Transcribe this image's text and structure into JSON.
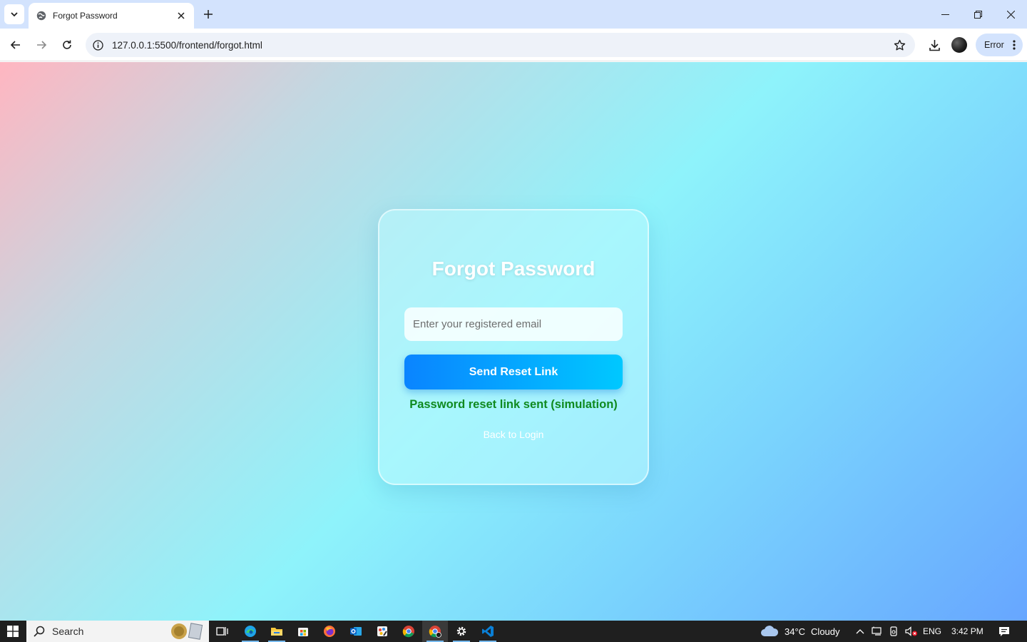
{
  "browser": {
    "tab": {
      "title": "Forgot Password"
    },
    "address_bar": {
      "url": "127.0.0.1:5500/frontend/forgot.html"
    },
    "profile_chip": {
      "label": "Error"
    }
  },
  "page": {
    "card": {
      "title": "Forgot Password",
      "email_input": {
        "placeholder": "Enter your registered email",
        "value": ""
      },
      "submit_button": {
        "label": "Send Reset Link"
      },
      "status_message": "Password reset link sent (simulation)",
      "back_link": {
        "label": "Back to Login"
      }
    }
  },
  "taskbar": {
    "search": {
      "label": "Search"
    },
    "pinned_apps": [
      "task-view",
      "edge",
      "file-explorer",
      "microsoft-store",
      "firefox",
      "outlook",
      "paint",
      "chrome",
      "chrome-active",
      "settings",
      "vscode"
    ],
    "weather": {
      "temperature": "34°C",
      "condition": "Cloudy"
    },
    "language": "ENG",
    "clock": "3:42 PM"
  },
  "colors": {
    "gradient_start": "#ffb6c1",
    "gradient_mid": "#8ef3fb",
    "gradient_end": "#67a6ff",
    "button_start": "#0a84ff",
    "button_end": "#00c8ff",
    "success_text": "#0f8a1f"
  }
}
